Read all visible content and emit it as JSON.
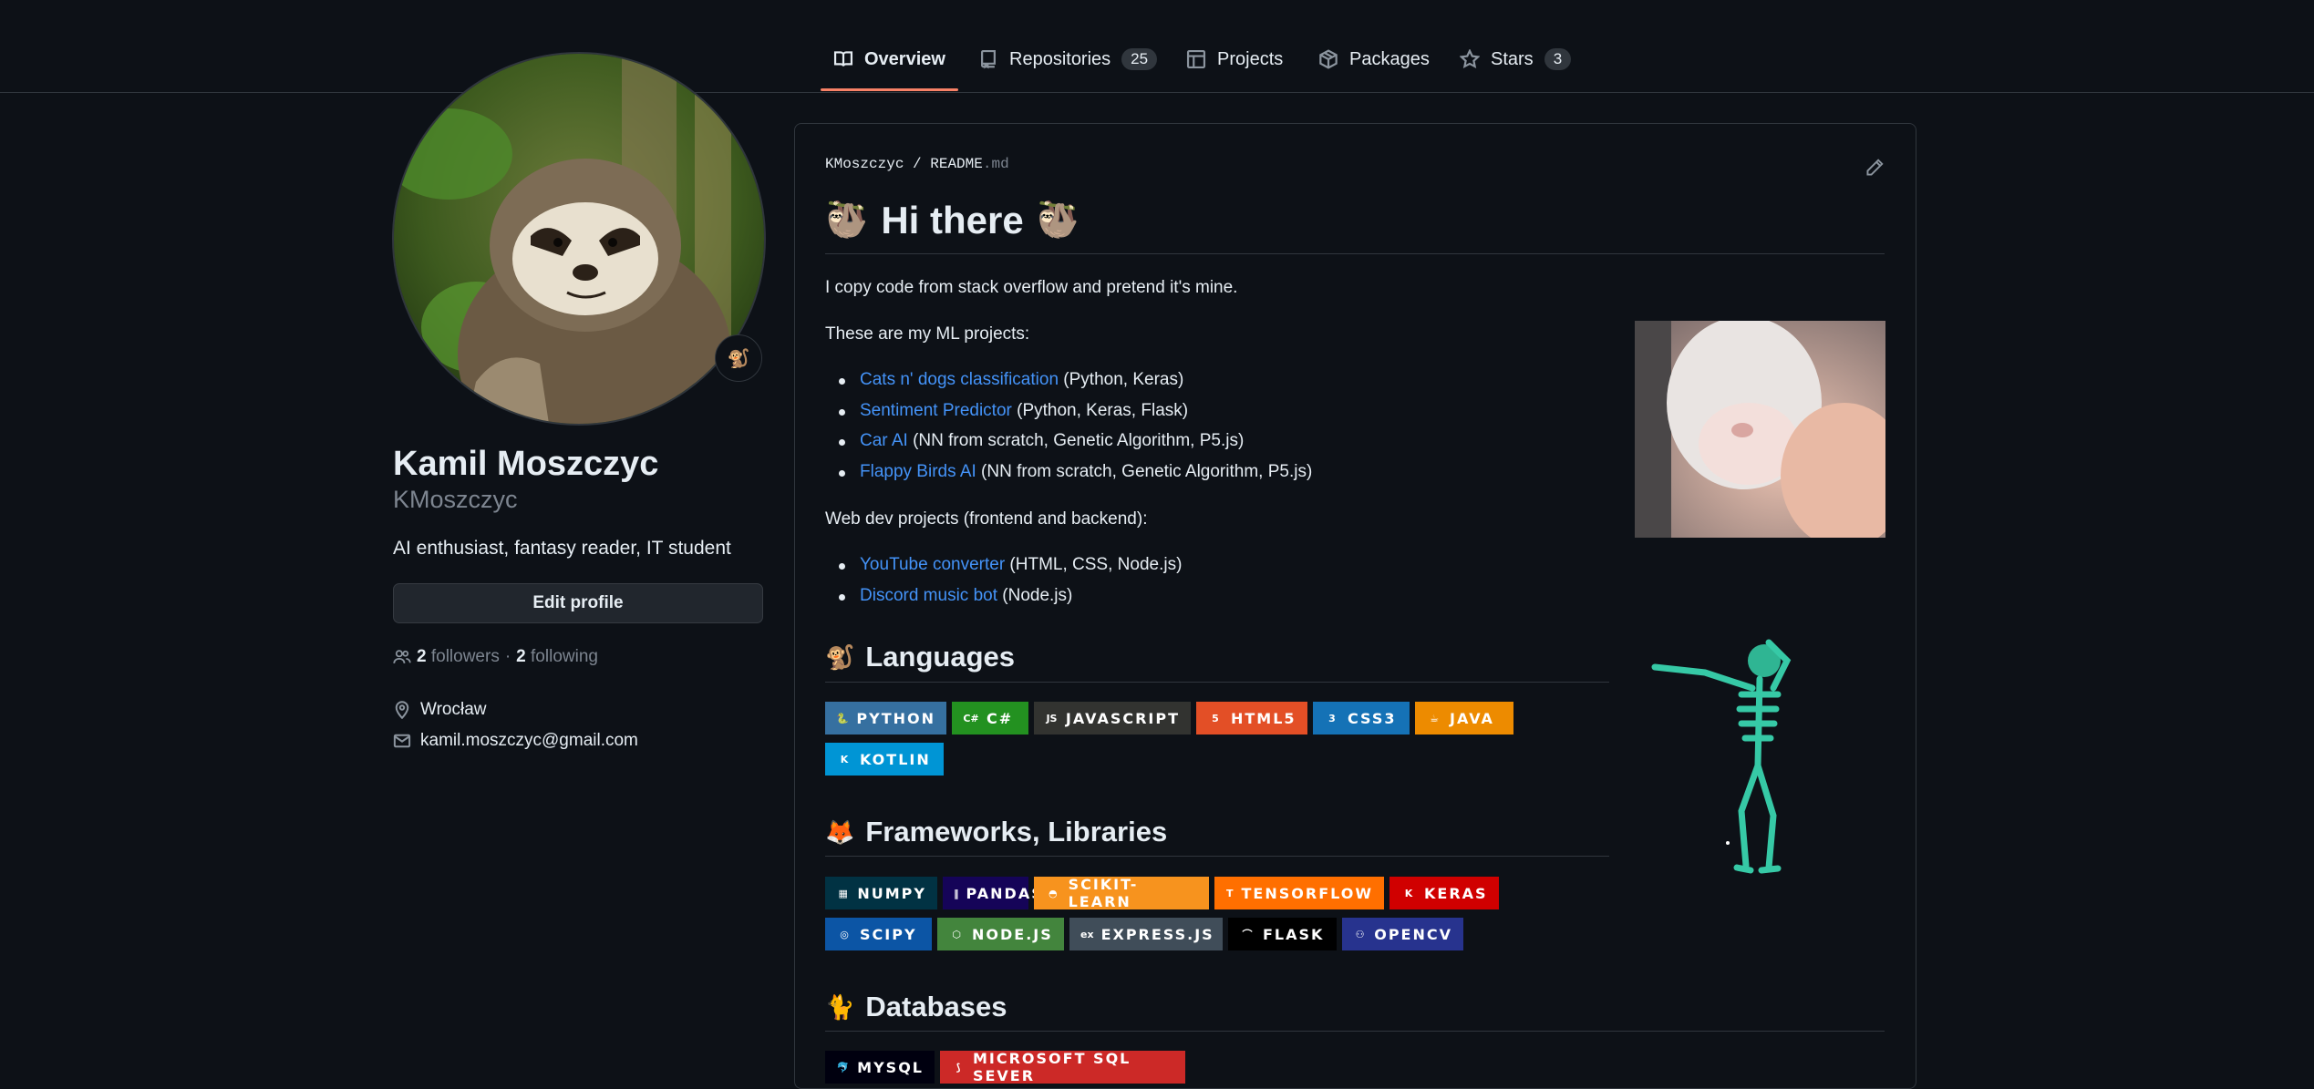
{
  "nav": {
    "tabs": [
      {
        "label": "Overview",
        "icon": "book-icon"
      },
      {
        "label": "Repositories",
        "count": "25",
        "icon": "repo-icon"
      },
      {
        "label": "Projects",
        "icon": "table-icon"
      },
      {
        "label": "Packages",
        "icon": "package-icon"
      },
      {
        "label": "Stars",
        "count": "3",
        "icon": "star-icon"
      }
    ]
  },
  "profile": {
    "name": "Kamil Moszczyc",
    "login": "KMoszczyc",
    "bio": "AI enthusiast, fantasy reader, IT student",
    "edit_label": "Edit profile",
    "followers_count": "2",
    "followers_label": "followers",
    "sep": "·",
    "following_count": "2",
    "following_label": "following",
    "location": "Wrocław",
    "email": "kamil.moszczyc@gmail.com",
    "status_emoji": "🐒"
  },
  "readme": {
    "owner": "KMoszczyc",
    "slash": "/",
    "file_base": "README",
    "file_ext": ".md",
    "h1_emoji": "🦥",
    "title": "Hi there",
    "intro": "I copy code from stack overflow and pretend it's mine.",
    "ml_heading": "These are my ML projects:",
    "ml_projects": [
      {
        "link": "Cats n' dogs classification",
        "rest": " (Python, Keras)"
      },
      {
        "link": "Sentiment Predictor",
        "rest": " (Python, Keras, Flask)"
      },
      {
        "link": "Car AI",
        "rest": " (NN from scratch, Genetic Algorithm, P5.js)"
      },
      {
        "link": "Flappy Birds AI",
        "rest": " (NN from scratch, Genetic Algorithm, P5.js)"
      }
    ],
    "web_heading": "Web dev projects (frontend and backend):",
    "web_projects": [
      {
        "link": "YouTube converter",
        "rest": " (HTML, CSS, Node.js)"
      },
      {
        "link": "Discord music bot",
        "rest": " (Node.js)"
      }
    ],
    "sections": [
      {
        "emoji": "🐒",
        "title": "Languages"
      },
      {
        "emoji": "🦊",
        "title": "Frameworks, Libraries"
      },
      {
        "emoji": "🐈",
        "title": "Databases"
      }
    ],
    "languages": [
      {
        "label": "PYTHON",
        "color": "#3670a0",
        "icon": "python-icon",
        "glyph": "🐍"
      },
      {
        "label": "C#",
        "color": "#239120",
        "icon": "csharp-icon",
        "glyph": "C#"
      },
      {
        "label": "JAVASCRIPT",
        "color": "#323330",
        "icon": "javascript-icon",
        "glyph": "JS"
      },
      {
        "label": "HTML5",
        "color": "#e34f26",
        "icon": "html5-icon",
        "glyph": "5"
      },
      {
        "label": "CSS3",
        "color": "#1572b6",
        "icon": "css3-icon",
        "glyph": "3"
      },
      {
        "label": "JAVA",
        "color": "#ed8b00",
        "icon": "java-icon",
        "glyph": "☕"
      },
      {
        "label": "KOTLIN",
        "color": "#0095d5",
        "icon": "kotlin-icon",
        "glyph": "K"
      }
    ],
    "frameworks": [
      {
        "label": "NUMPY",
        "color": "#013243",
        "icon": "numpy-icon",
        "glyph": "▦"
      },
      {
        "label": "PANDAS",
        "color": "#150458",
        "icon": "pandas-icon",
        "glyph": "‖"
      },
      {
        "label": "SCIKIT-LEARN",
        "color": "#f7931e",
        "icon": "scikit-learn-icon",
        "glyph": "◓"
      },
      {
        "label": "TENSORFLOW",
        "color": "#ff6f00",
        "icon": "tensorflow-icon",
        "glyph": "T"
      },
      {
        "label": "KERAS",
        "color": "#d00000",
        "icon": "keras-icon",
        "glyph": "K"
      },
      {
        "label": "SCIPY",
        "color": "#0c55a5",
        "icon": "scipy-icon",
        "glyph": "◎"
      },
      {
        "label": "NODE.JS",
        "color": "#43853d",
        "icon": "nodejs-icon",
        "glyph": "⬡"
      },
      {
        "label": "EXPRESS.JS",
        "color": "#404d59",
        "icon": "express-icon",
        "glyph": "ex"
      },
      {
        "label": "FLASK",
        "color": "#000000",
        "icon": "flask-icon",
        "glyph": "⌒"
      },
      {
        "label": "OPENCV",
        "color": "#27338e",
        "icon": "opencv-icon",
        "glyph": "⚇"
      }
    ],
    "databases": [
      {
        "label": "MYSQL",
        "color": "#00000f",
        "icon": "mysql-icon",
        "glyph": "🐬"
      },
      {
        "label": "MICROSOFT SQL SEVER",
        "color": "#cc2927",
        "icon": "sql-server-icon",
        "glyph": "⟆"
      }
    ]
  }
}
